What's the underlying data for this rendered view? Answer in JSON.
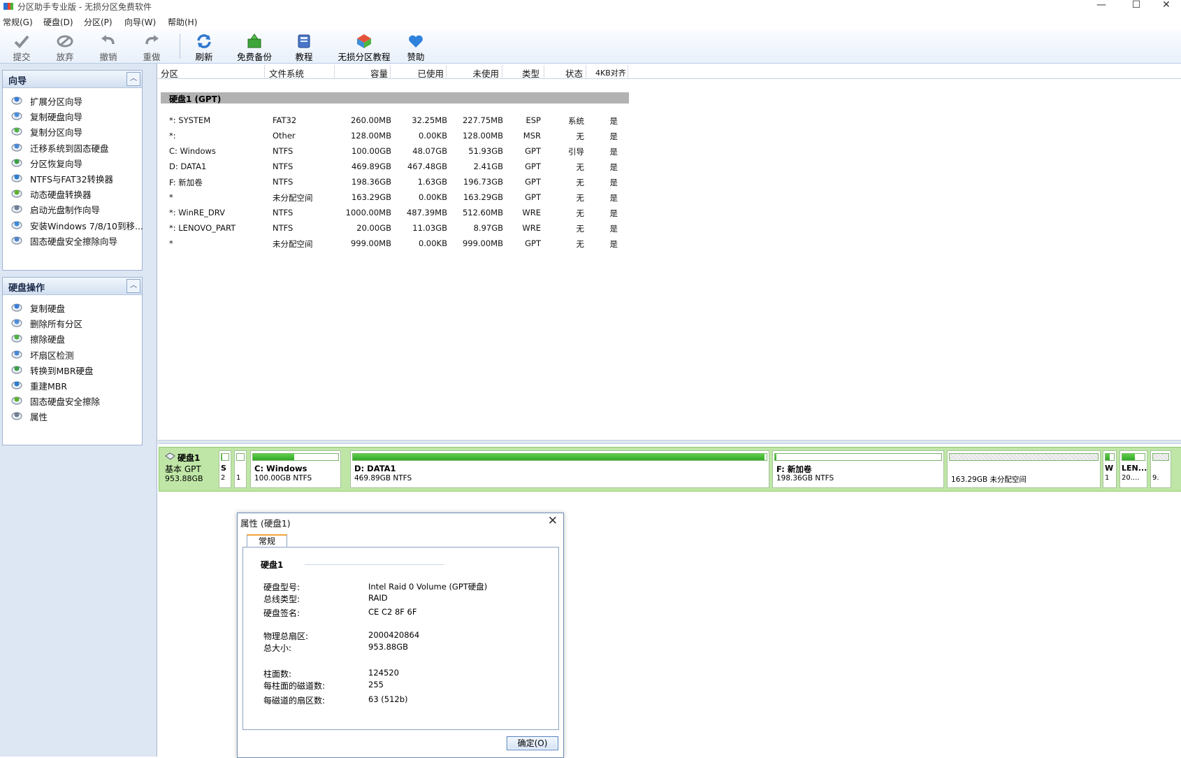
{
  "window": {
    "title": "分区助手专业版 - 无损分区免费软件",
    "min": "—",
    "max": "☐",
    "close": "✕"
  },
  "menu": [
    "常规(G)",
    "硬盘(D)",
    "分区(P)",
    "向导(W)",
    "帮助(H)"
  ],
  "toolbar": [
    {
      "label": "提交",
      "icon": "check-icon"
    },
    {
      "label": "放弃",
      "icon": "discard-icon"
    },
    {
      "label": "撤销",
      "icon": "undo-icon"
    },
    {
      "label": "重做",
      "icon": "redo-icon"
    },
    {
      "label": "刷新",
      "icon": "refresh-icon"
    },
    {
      "label": "免费备份",
      "icon": "backup-icon"
    },
    {
      "label": "教程",
      "icon": "tutorial-icon"
    },
    {
      "label": "无损分区教程",
      "icon": "partition-tutorial-icon"
    },
    {
      "label": "赞助",
      "icon": "heart-icon"
    }
  ],
  "sidebar": {
    "wizard": {
      "title": "向导",
      "items": [
        "扩展分区向导",
        "复制硬盘向导",
        "复制分区向导",
        "迁移系统到固态硬盘",
        "分区恢复向导",
        "NTFS与FAT32转换器",
        "动态硬盘转换器",
        "启动光盘制作向导",
        "安装Windows 7/8/10到移...",
        "固态硬盘安全擦除向导"
      ]
    },
    "disk_ops": {
      "title": "硬盘操作",
      "items": [
        "复制硬盘",
        "删除所有分区",
        "擦除硬盘",
        "坏扇区检测",
        "转换到MBR硬盘",
        "重建MBR",
        "固态硬盘安全擦除",
        "属性"
      ]
    }
  },
  "list": {
    "headers": [
      "分区",
      "文件系统",
      "容量",
      "已使用",
      "未使用",
      "类型",
      "状态",
      "4KB对齐"
    ],
    "disk_group": "硬盘1 (GPT)",
    "rows": [
      [
        "*: SYSTEM",
        "FAT32",
        "260.00MB",
        "32.25MB",
        "227.75MB",
        "ESP",
        "系统",
        "是"
      ],
      [
        "*:",
        "Other",
        "128.00MB",
        "0.00KB",
        "128.00MB",
        "MSR",
        "无",
        "是"
      ],
      [
        "C: Windows",
        "NTFS",
        "100.00GB",
        "48.07GB",
        "51.93GB",
        "GPT",
        "引导",
        "是"
      ],
      [
        "D: DATA1",
        "NTFS",
        "469.89GB",
        "467.48GB",
        "2.41GB",
        "GPT",
        "无",
        "是"
      ],
      [
        "F: 新加卷",
        "NTFS",
        "198.36GB",
        "1.63GB",
        "196.73GB",
        "GPT",
        "无",
        "是"
      ],
      [
        "*",
        "未分配空间",
        "163.29GB",
        "0.00KB",
        "163.29GB",
        "GPT",
        "无",
        "是"
      ],
      [
        "*: WinRE_DRV",
        "NTFS",
        "1000.00MB",
        "487.39MB",
        "512.60MB",
        "WRE",
        "无",
        "是"
      ],
      [
        "*: LENOVO_PART",
        "NTFS",
        "20.00GB",
        "11.03GB",
        "8.97GB",
        "WRE",
        "无",
        "是"
      ],
      [
        "*",
        "未分配空间",
        "999.00MB",
        "0.00KB",
        "999.00MB",
        "GPT",
        "无",
        "是"
      ]
    ]
  },
  "diskmap": {
    "name": "硬盘1",
    "type": "基本 GPT",
    "size": "953.88GB",
    "parts": [
      {
        "label": "S",
        "sub": "2",
        "used": 0.12
      },
      {
        "label": "",
        "sub": "1",
        "used": 0.0
      },
      {
        "label": "C: Windows",
        "sub": "100.00GB NTFS",
        "used": 0.48
      },
      {
        "label": "D: DATA1",
        "sub": "469.89GB NTFS",
        "used": 0.995
      },
      {
        "label": "F: 新加卷",
        "sub": "198.36GB NTFS",
        "used": 0.01
      },
      {
        "label": "",
        "sub": "163.29GB 未分配空间",
        "used": 0.0
      },
      {
        "label": "W",
        "sub": "1",
        "used": 0.49
      },
      {
        "label": "LEN...",
        "sub": "20....",
        "used": 0.55
      },
      {
        "label": "",
        "sub": "9.",
        "used": 0.0
      }
    ]
  },
  "dialog": {
    "title": "属性 (硬盘1)",
    "tab": "常规",
    "group": "硬盘1",
    "props": [
      {
        "label": "硬盘型号:",
        "value": "Intel   Raid 0 Volume (GPT硬盘)"
      },
      {
        "label": "总线类型:",
        "value": "RAID"
      },
      {
        "label": "硬盘签名:",
        "value": "CE C2 8F 6F"
      },
      {
        "label": "物理总扇区:",
        "value": "2000420864"
      },
      {
        "label": "总大小:",
        "value": "953.88GB"
      },
      {
        "label": "柱面数:",
        "value": "124520"
      },
      {
        "label": "每柱面的磁道数:",
        "value": "255"
      },
      {
        "label": "每磁道的扇区数:",
        "value": "63 (512b)"
      }
    ],
    "ok": "确定(O)"
  }
}
